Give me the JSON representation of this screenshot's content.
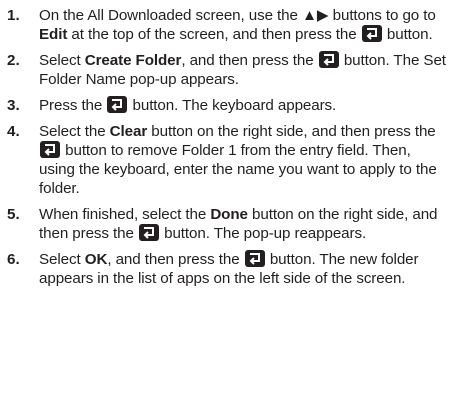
{
  "steps": [
    {
      "number": "1.",
      "parts": [
        {
          "t": "On the All Downloaded screen, use the ▲▶ buttons to go to "
        },
        {
          "b": "Edit"
        },
        {
          "t": " at the top of the screen, and then press the "
        },
        {
          "icon": "enter-button-icon"
        },
        {
          "t": " button."
        }
      ]
    },
    {
      "number": "2.",
      "parts": [
        {
          "t": "Select "
        },
        {
          "b": "Create Folder"
        },
        {
          "t": ", and then press the "
        },
        {
          "icon": "enter-button-icon"
        },
        {
          "t": " button. The Set Folder Name pop-up appears."
        }
      ]
    },
    {
      "number": "3.",
      "parts": [
        {
          "t": "Press the "
        },
        {
          "icon": "enter-button-icon"
        },
        {
          "t": " button. The keyboard appears."
        }
      ]
    },
    {
      "number": "4.",
      "parts": [
        {
          "t": "Select the "
        },
        {
          "b": "Clear"
        },
        {
          "t": " button on the right side, and then press the "
        },
        {
          "icon": "enter-button-icon"
        },
        {
          "t": " button to remove Folder 1 from the entry field. Then, using the keyboard, enter the name you want to apply to the folder."
        }
      ]
    },
    {
      "number": "5.",
      "parts": [
        {
          "t": "When finished, select the "
        },
        {
          "b": "Done"
        },
        {
          "t": " button on the right side, and then press the "
        },
        {
          "icon": "enter-button-icon"
        },
        {
          "t": " button. The pop-up reappears."
        }
      ]
    },
    {
      "number": "6.",
      "parts": [
        {
          "t": "Select "
        },
        {
          "b": "OK"
        },
        {
          "t": ", and then press the "
        },
        {
          "icon": "enter-button-icon"
        },
        {
          "t": " button. The new folder appears in the list of apps on the left side of the screen."
        }
      ]
    }
  ]
}
